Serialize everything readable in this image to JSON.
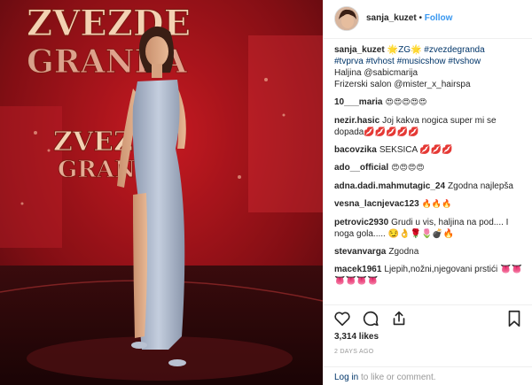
{
  "post": {
    "photo_signage": [
      "ZVEZDE",
      "GRANDA",
      "ZVEZDE",
      "GRANDA"
    ],
    "author": {
      "username": "sanja_kuzet",
      "separator": "•",
      "follow_label": "Follow"
    },
    "caption": {
      "username": "sanja_kuzet",
      "line1": "🌟ZG🌟 #zvezdegranda",
      "line2": "#tvprva #tvhost #musicshow #tvshow",
      "line3": "Haljina @sabicmarija",
      "line4": "Frizerski salon @mister_x_hairspa"
    },
    "comments": [
      {
        "user": "10___maria",
        "text": "😍😍😍😍😍"
      },
      {
        "user": "nezir.hasic",
        "text": "Joj kakva nogica super mi se dopada💋💋💋💋💋"
      },
      {
        "user": "bacovzika",
        "text": "SEKSICA 💋💋💋"
      },
      {
        "user": "ado__official",
        "text": "😍😍😍😍"
      },
      {
        "user": "adna.dadi.mahmutagic_24",
        "text": "Zgodna najlepša"
      },
      {
        "user": "vesna_lacnjevac123",
        "text": "🔥🔥🔥"
      },
      {
        "user": "petrovic2930",
        "text": "Grudi u vis, haljina na pod.... I noga gola..... 😏👌🌹🌷💣🔥"
      },
      {
        "user": "stevanvarga",
        "text": "Zgodna"
      },
      {
        "user": "macek1961",
        "text": "Ljepih,nožni,njegovani prstići 👅👅👅👅👅👅"
      }
    ],
    "likes": "3,314 likes",
    "time": "2 DAYS AGO",
    "login": {
      "link": "Log in",
      "text": " to like or comment."
    }
  },
  "icons": [
    "heart-icon",
    "comment-icon",
    "share-icon",
    "bookmark-icon"
  ],
  "colors": {
    "link": "#3897f0",
    "hashtag": "#003569",
    "muted": "#999999",
    "stage_red": "#b3141c"
  }
}
